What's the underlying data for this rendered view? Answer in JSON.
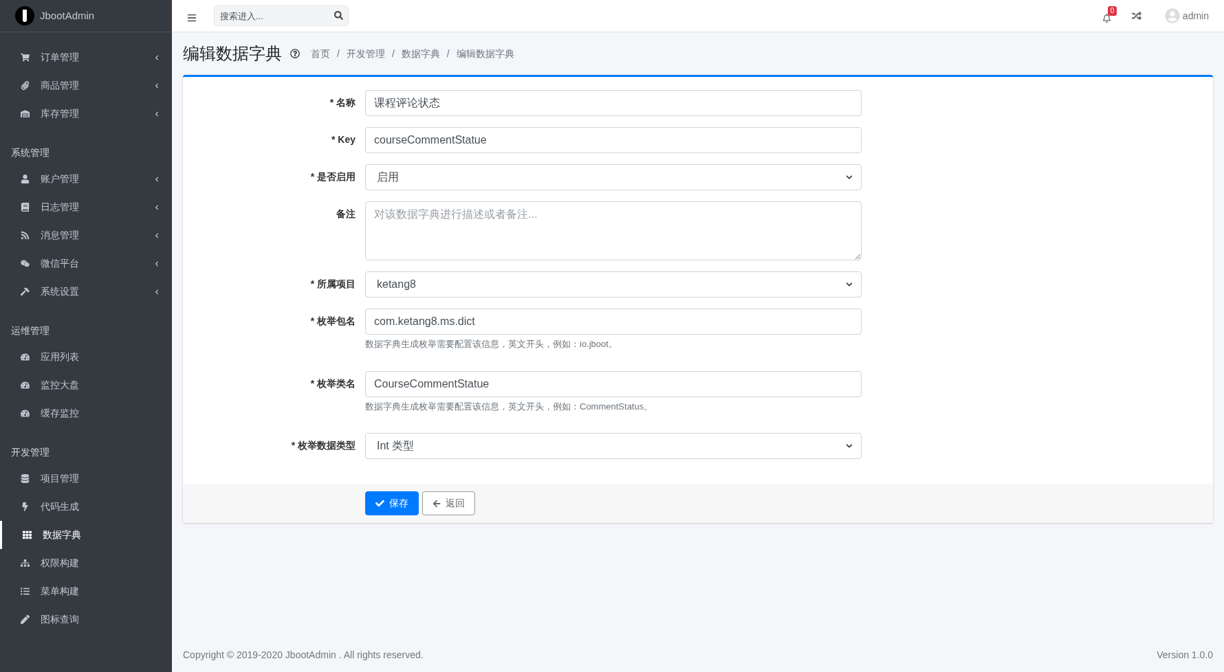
{
  "brand": {
    "name": "JbootAdmin"
  },
  "sidebar": {
    "groups": [
      {
        "items": [
          {
            "label": "订单管理",
            "has_submenu": true,
            "selected": false
          },
          {
            "label": "商品管理",
            "has_submenu": true,
            "selected": false
          },
          {
            "label": "库存管理",
            "has_submenu": true,
            "selected": false
          }
        ]
      },
      {
        "title": "系统管理",
        "items": [
          {
            "label": "账户管理",
            "has_submenu": true,
            "selected": false
          },
          {
            "label": "日志管理",
            "has_submenu": true,
            "selected": false
          },
          {
            "label": "消息管理",
            "has_submenu": true,
            "selected": false
          },
          {
            "label": "微信平台",
            "has_submenu": true,
            "selected": false
          },
          {
            "label": "系统设置",
            "has_submenu": true,
            "selected": false
          }
        ]
      },
      {
        "title": "运维管理",
        "items": [
          {
            "label": "应用列表",
            "has_submenu": false,
            "selected": false
          },
          {
            "label": "监控大盘",
            "has_submenu": false,
            "selected": false
          },
          {
            "label": "缓存监控",
            "has_submenu": false,
            "selected": false
          }
        ]
      },
      {
        "title": "开发管理",
        "items": [
          {
            "label": "项目管理",
            "has_submenu": false,
            "selected": false
          },
          {
            "label": "代码生成",
            "has_submenu": false,
            "selected": false
          },
          {
            "label": "数据字典",
            "has_submenu": false,
            "selected": true
          },
          {
            "label": "权限构建",
            "has_submenu": false,
            "selected": false
          },
          {
            "label": "菜单构建",
            "has_submenu": false,
            "selected": false
          },
          {
            "label": "图标查询",
            "has_submenu": false,
            "selected": false
          }
        ]
      }
    ]
  },
  "topbar": {
    "search": {
      "placeholder": "搜索进入..."
    },
    "notifications": "0",
    "user": "admin"
  },
  "page": {
    "title": "编辑数据字典",
    "breadcrumb": [
      "首页",
      "开发管理",
      "数据字典",
      "编辑数据字典"
    ],
    "separator": "/"
  },
  "form": {
    "required_mark": "*",
    "fields": [
      {
        "kind": "text",
        "label": "名称",
        "required": true,
        "value": "课程评论状态"
      },
      {
        "kind": "text",
        "label": "Key",
        "required": true,
        "value": "courseCommentStatue"
      },
      {
        "kind": "select",
        "label": "是否启用",
        "required": true,
        "value": "启用"
      },
      {
        "kind": "textarea",
        "label": "备注",
        "required": false,
        "placeholder": "对该数据字典进行描述或者备注..."
      },
      {
        "kind": "select",
        "label": "所属项目",
        "required": true,
        "value": "ketang8"
      },
      {
        "kind": "text",
        "label": "枚举包名",
        "required": true,
        "value": "com.ketang8.ms.dict",
        "help": "数据字典生成枚举需要配置该信息，英文开头，例如：io.jboot。"
      },
      {
        "kind": "text",
        "label": "枚举类名",
        "required": true,
        "value": "CourseCommentStatue",
        "help": "数据字典生成枚举需要配置该信息，英文开头，例如：CommentStatus。"
      },
      {
        "kind": "select",
        "label": "枚举数据类型",
        "required": true,
        "value": "Int 类型"
      }
    ],
    "buttons": [
      {
        "kind": "primary",
        "label": "保存"
      },
      {
        "kind": "default",
        "label": "返回"
      }
    ]
  },
  "footer": {
    "copyright": "Copyright © 2019-2020 JbootAdmin . All rights reserved.",
    "version": "Version 1.0.0"
  }
}
